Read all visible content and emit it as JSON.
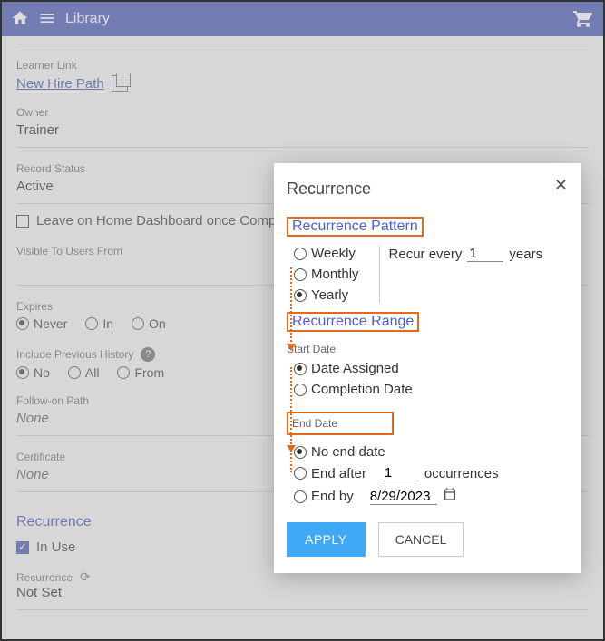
{
  "header": {
    "title": "Library"
  },
  "fields": {
    "learner_link_label": "Learner Link",
    "learner_link_value": "New Hire Path",
    "owner_label": "Owner",
    "owner_value": "Trainer",
    "record_status_label": "Record Status",
    "record_status_value": "Active",
    "leave_dashboard_label": "Leave on Home Dashboard once Comp",
    "visible_to_label": "Visible To Users From",
    "expires_label": "Expires",
    "expires": {
      "never": "Never",
      "in": "In",
      "on": "On"
    },
    "include_prev_label": "Include Previous History",
    "include_prev": {
      "no": "No",
      "all": "All",
      "from": "From"
    },
    "followon_label": "Follow-on Path",
    "followon_value": "None",
    "certificate_label": "Certificate",
    "certificate_value": "None",
    "recurrence_section": "Recurrence",
    "in_use_label": "In Use",
    "recurrence_label": "Recurrence",
    "recurrence_value": "Not Set"
  },
  "modal": {
    "title": "Recurrence",
    "pattern_title": "Recurrence Pattern",
    "pattern": {
      "weekly": "Weekly",
      "monthly": "Monthly",
      "yearly": "Yearly"
    },
    "recur_every_prefix": "Recur every",
    "recur_every_value": "1",
    "recur_every_unit": "years",
    "range_title": "Recurrence Range",
    "start_date_label": "Start Date",
    "start_date": {
      "date_assigned": "Date Assigned",
      "completion_date": "Completion Date"
    },
    "end_date_label": "End Date",
    "end": {
      "no_end": "No end date",
      "end_after_prefix": "End after",
      "end_after_value": "1",
      "end_after_suffix": "occurrences",
      "end_by_prefix": "End by",
      "end_by_value": "8/29/2023"
    },
    "buttons": {
      "apply": "APPLY",
      "cancel": "CANCEL"
    }
  }
}
